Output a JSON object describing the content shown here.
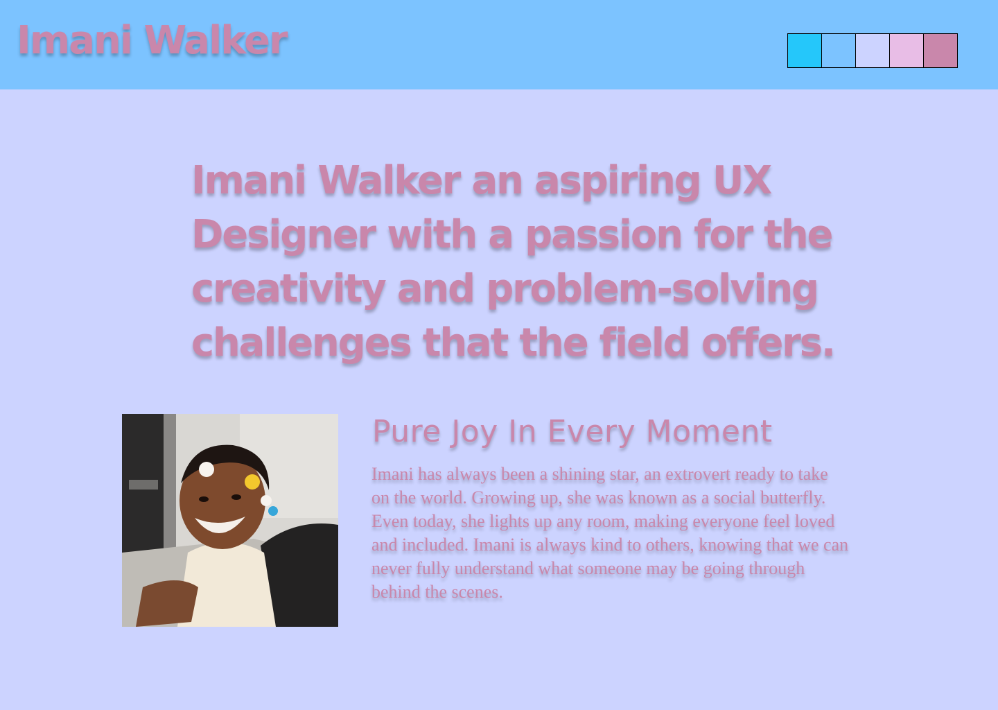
{
  "header": {
    "site_title": "Imani Walker",
    "palette": [
      {
        "name": "swatch-sky",
        "color": "#25c7fa"
      },
      {
        "name": "swatch-blue",
        "color": "#7cc3ff"
      },
      {
        "name": "swatch-lavender",
        "color": "#ccd3ff"
      },
      {
        "name": "swatch-pink",
        "color": "#e8bde6"
      },
      {
        "name": "swatch-rose",
        "color": "#c987ab"
      }
    ]
  },
  "hero": {
    "headline": "Imani Walker an aspiring UX Designer with a passion for the creativity and problem-solving challenges that the field offers."
  },
  "about": {
    "title": "Pure Joy In Every Moment",
    "body": "Imani has always been a shining star, an extrovert ready to take on the world. Growing up, she was known as a social butterfly. Even today, she lights up any room, making everyone feel loved and included. Imani is always kind to others, knowing that we can never fully understand what someone may be going through behind the scenes."
  },
  "colors": {
    "header_bg": "#7cc3ff",
    "page_bg": "#ccd3ff",
    "accent_text": "#c987ab"
  }
}
